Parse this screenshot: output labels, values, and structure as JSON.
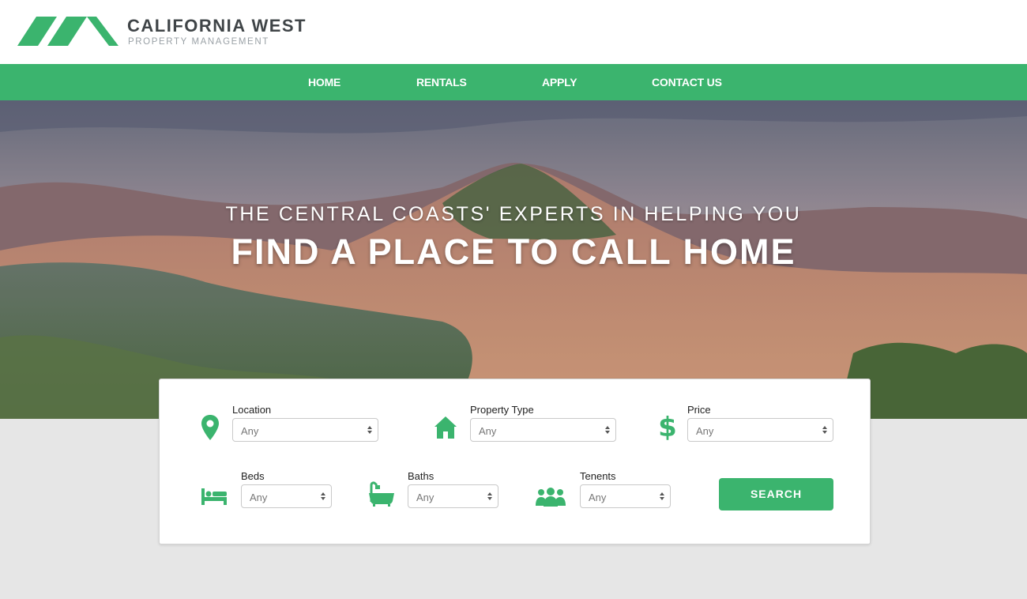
{
  "brand": {
    "name": "CALIFORNIA WEST",
    "tagline": "PROPERTY MANAGEMENT",
    "color": "#3bb46e"
  },
  "nav": {
    "items": [
      {
        "label": "HOME"
      },
      {
        "label": "RENTALS"
      },
      {
        "label": "APPLY"
      },
      {
        "label": "CONTACT US"
      }
    ]
  },
  "hero": {
    "subtitle": "THE CENTRAL COASTS' EXPERTS IN HELPING YOU",
    "title": "FIND A PLACE TO CALL HOME"
  },
  "search": {
    "fields": [
      {
        "label": "Location",
        "value": "Any",
        "icon": "map-pin-icon"
      },
      {
        "label": "Property Type",
        "value": "Any",
        "icon": "house-icon"
      },
      {
        "label": "Price",
        "value": "Any",
        "icon": "dollar-icon"
      },
      {
        "label": "Beds",
        "value": "Any",
        "icon": "bed-icon"
      },
      {
        "label": "Baths",
        "value": "Any",
        "icon": "bathtub-icon"
      },
      {
        "label": "Tenents",
        "value": "Any",
        "icon": "people-icon"
      }
    ],
    "button_label": "SEARCH"
  }
}
